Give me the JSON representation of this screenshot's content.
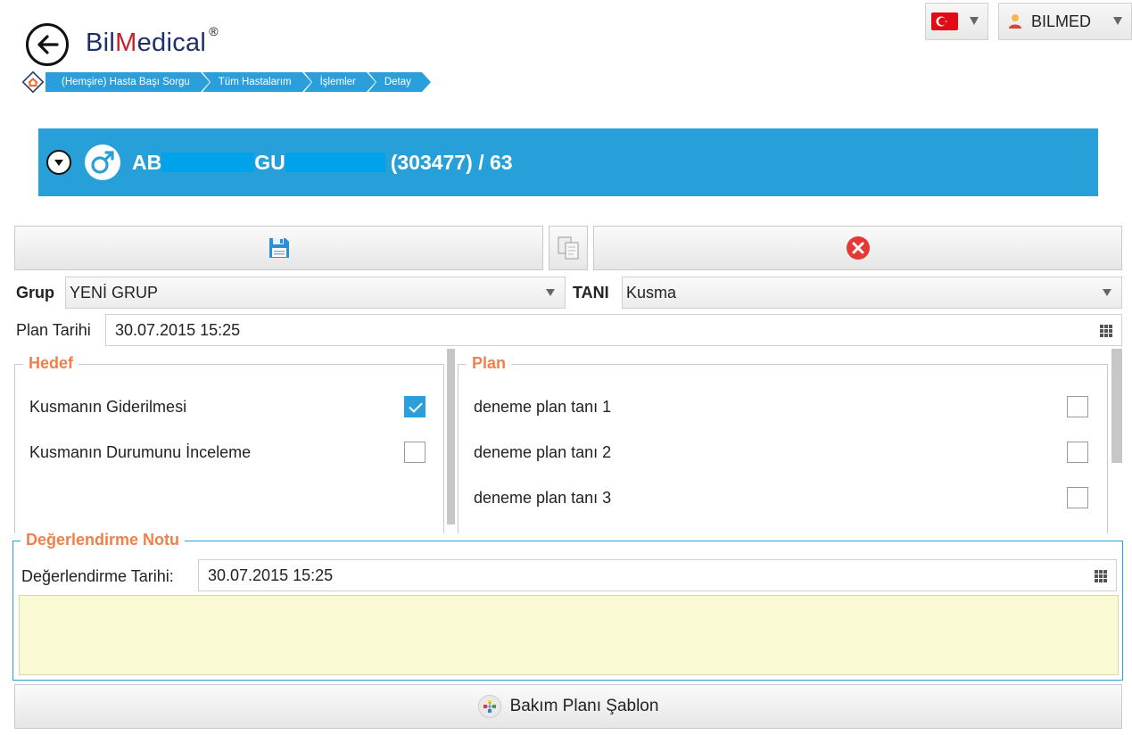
{
  "header": {
    "brand_prefix": "Bil",
    "brand_m": "M",
    "brand_suffix": "edical",
    "brand_mark": "®",
    "back_icon": "arrow-left-icon",
    "breadcrumb": [
      "(Hemşire) Hasta Başı Sorgu",
      "Tüm Hastalarım",
      "İşlemler",
      "Detay"
    ],
    "language_icon": "turkey-flag-icon",
    "user_name": "BILMED",
    "user_icon": "user-icon"
  },
  "patient": {
    "name_start": "AB",
    "surname_start": "GU",
    "id_age": "(303477) / 63",
    "gender_icon": "male-symbol-icon"
  },
  "toolbar": {
    "save_icon": "floppy-disk-icon",
    "copy_icon": "copy-documents-icon",
    "cancel_icon": "cancel-circle-icon"
  },
  "form": {
    "group_label": "Grup",
    "group_value": "YENİ GRUP",
    "diagnosis_label": "TANI",
    "diagnosis_value": "Kusma",
    "plan_date_label": "Plan Tarihi",
    "plan_date_value": "30.07.2015 15:25"
  },
  "goals": {
    "title": "Hedef",
    "items": [
      {
        "label": "Kusmanın Giderilmesi",
        "checked": true
      },
      {
        "label": "Kusmanın Durumunu İnceleme",
        "checked": false
      }
    ]
  },
  "plan": {
    "title": "Plan",
    "items": [
      {
        "label": "deneme plan tanı 1",
        "checked": false
      },
      {
        "label": "deneme plan tanı 2",
        "checked": false
      },
      {
        "label": "deneme plan tanı 3",
        "checked": false
      }
    ]
  },
  "evaluation": {
    "title": "Değerlendirme Notu",
    "date_label": "Değerlendirme Tarihi:",
    "date_value": "30.07.2015 15:25",
    "note_value": ""
  },
  "template_button": {
    "label": "Bakım Planı Şablon",
    "icon": "template-icon"
  },
  "colors": {
    "accent": "#27a0da",
    "section_title": "#f0804a",
    "note_bg": "#f9f9d3"
  }
}
